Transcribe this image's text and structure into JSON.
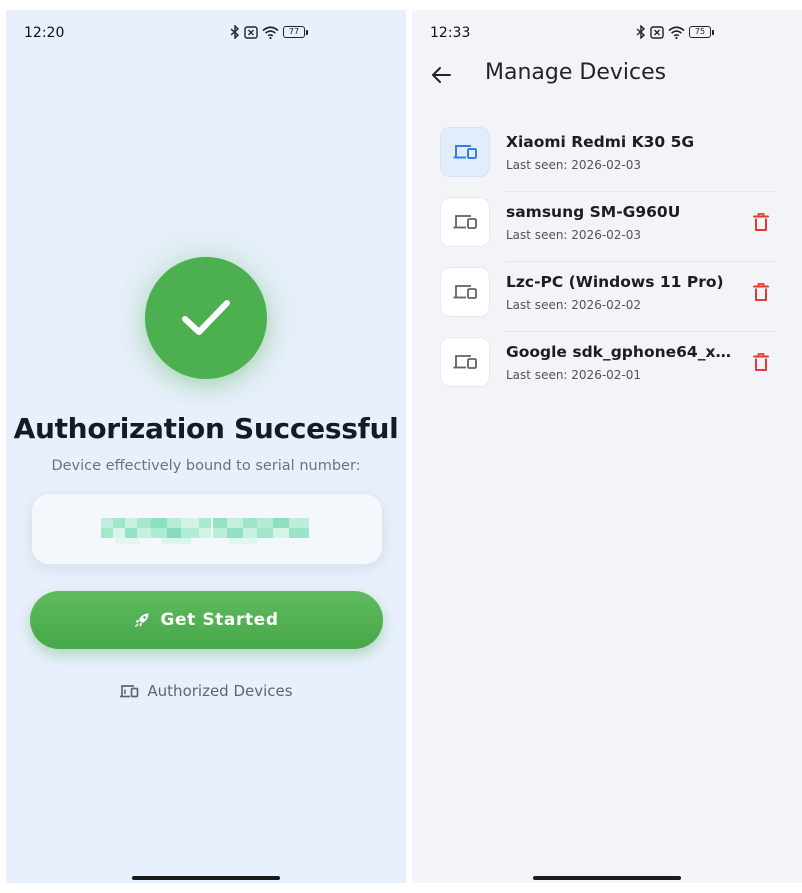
{
  "left_screen": {
    "status": {
      "time": "12:20",
      "battery": "77"
    },
    "title": "Authorization Successful",
    "subtitle": "Device effectively bound to serial number:",
    "start_button": {
      "icon": "rocket-icon",
      "label": "Get Started"
    },
    "authorized_link": {
      "icon": "devices-icon",
      "label": "Authorized Devices"
    },
    "colors": {
      "background": "#e9f0fd",
      "success": "#4caf50",
      "button": "#4caf50"
    }
  },
  "right_screen": {
    "status": {
      "time": "12:33",
      "battery": "75"
    },
    "app_bar": {
      "back_icon": "arrow-left-icon",
      "title": "Manage Devices"
    },
    "devices": [
      {
        "name": "Xiaomi Redmi K30 5G",
        "last_seen": "Last seen: 2026-02-03",
        "current": true,
        "deletable": false
      },
      {
        "name": "samsung SM-G960U",
        "last_seen": "Last seen: 2026-02-03",
        "current": false,
        "deletable": true
      },
      {
        "name": "Lzc-PC (Windows 11 Pro)",
        "last_seen": "Last seen: 2026-02-02",
        "current": false,
        "deletable": true
      },
      {
        "name": "Google sdk_gphone64_x86_...",
        "last_seen": "Last seen: 2026-02-01",
        "current": false,
        "deletable": true
      }
    ],
    "colors": {
      "background": "#f3f4f8",
      "accent": "#2f80ed",
      "delete": "#e53935"
    }
  }
}
